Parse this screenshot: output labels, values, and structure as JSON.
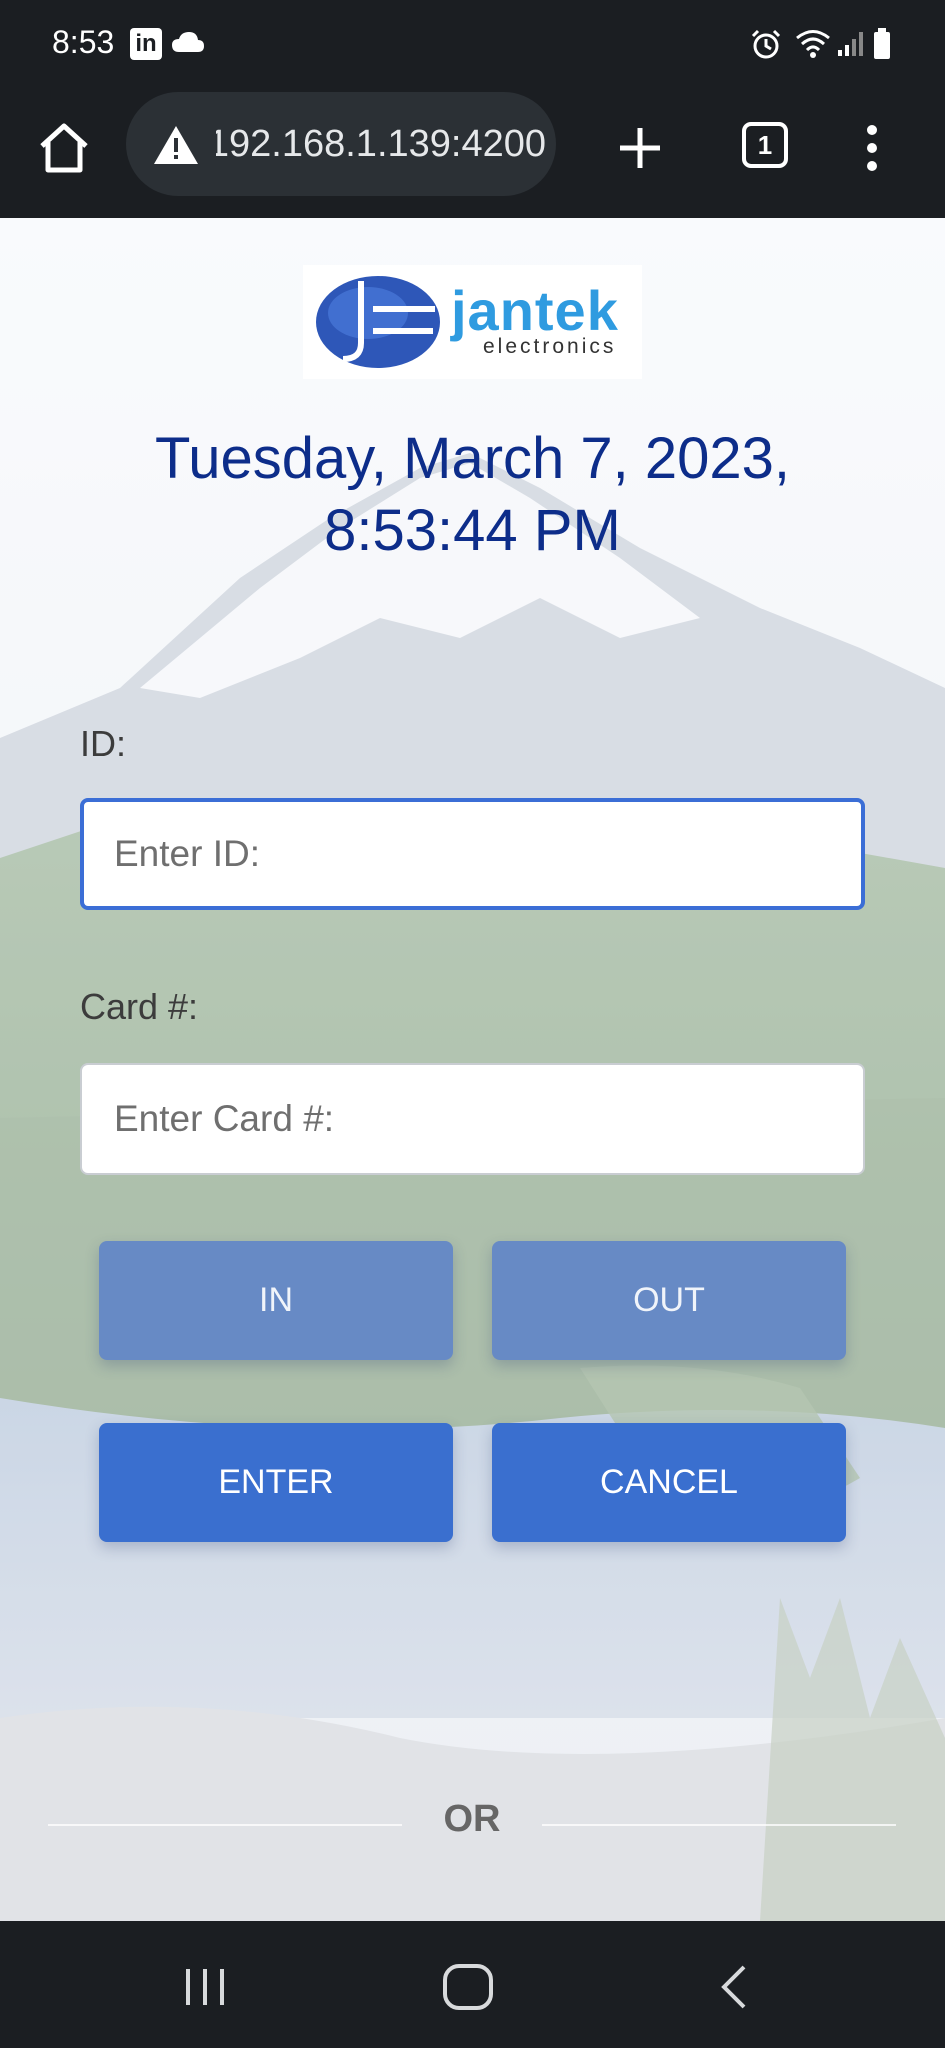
{
  "status_bar": {
    "time": "8:53",
    "icons": [
      "linkedin-icon",
      "cloud-icon",
      "alarm-icon",
      "wifi-icon",
      "signal-icon",
      "battery-icon"
    ]
  },
  "browser": {
    "url": "192.168.1.139:4200",
    "tab_count": "1"
  },
  "app": {
    "logo": {
      "word": "jantek",
      "sub": "electronics"
    },
    "datetime_line1": "Tuesday, March 7, 2023,",
    "datetime_line2": "8:53:44 PM",
    "id_label": "ID:",
    "id_placeholder": "Enter ID:",
    "id_value": "",
    "card_label": "Card #:",
    "card_placeholder": "Enter Card #:",
    "card_value": "",
    "buttons": {
      "in": "IN",
      "out": "OUT",
      "enter": "ENTER",
      "cancel": "CANCEL"
    },
    "divider_text": "OR"
  },
  "colors": {
    "title": "#0d2d8a",
    "primary_button": "#3a6fcf",
    "focus_border": "#3b6ed6",
    "logo_blue": "#2f9be0"
  }
}
